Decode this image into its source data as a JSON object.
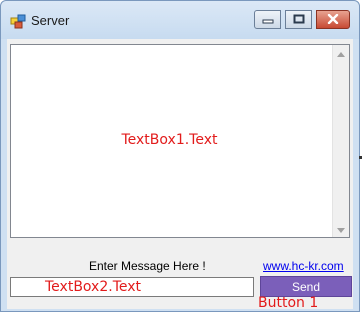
{
  "window": {
    "title": "Server",
    "icons": {
      "app": "server-app-icon",
      "minimize": "minimize-icon",
      "maximize": "maximize-icon",
      "close": "close-icon"
    }
  },
  "textbox1": {
    "text": "TextBox1.Text"
  },
  "label_enter": "Enter Message Here !",
  "link": "www.hc-kr.com",
  "textbox2": {
    "text": "TextBox2.Text"
  },
  "send_button": {
    "label": "Send"
  },
  "button_caption": "Button 1",
  "colors": {
    "annotation": "#e21b1b",
    "send_button": "#7b5fba",
    "link": "#0000ee"
  }
}
